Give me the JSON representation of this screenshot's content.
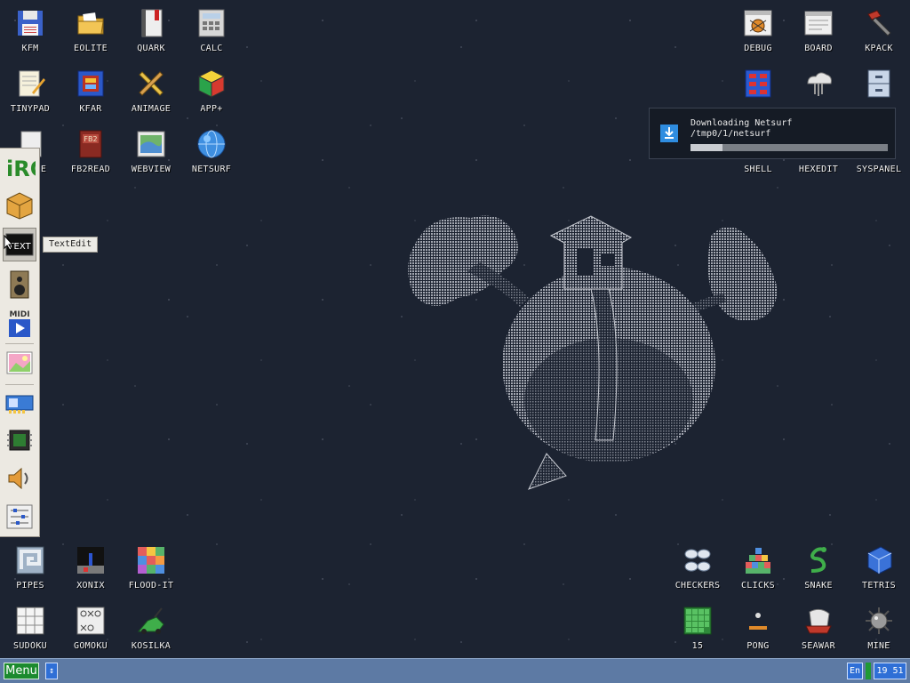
{
  "desktop": {
    "icons": [
      {
        "label": "KFM",
        "icon": "floppy-disk-icon"
      },
      {
        "label": "EOLITE",
        "icon": "folder-icon"
      },
      {
        "label": "QUARK",
        "icon": "book-icon"
      },
      {
        "label": "CALC",
        "icon": "calculator-icon"
      },
      {
        "label": "TINYPAD",
        "icon": "notepad-icon"
      },
      {
        "label": "KFAR",
        "icon": "archive-icon"
      },
      {
        "label": "ANIMAGE",
        "icon": "pencil-ruler-icon"
      },
      {
        "label": "APP+",
        "icon": "rubik-cube-icon"
      },
      {
        "label": "E",
        "icon": "document-icon"
      },
      {
        "label": "FB2READ",
        "icon": "fb2-book-icon"
      },
      {
        "label": "WEBVIEW",
        "icon": "map-window-icon"
      },
      {
        "label": "NETSURF",
        "icon": "globe-icon"
      },
      {
        "label": "DEBUG",
        "icon": "bug-window-icon"
      },
      {
        "label": "BOARD",
        "icon": "board-window-icon"
      },
      {
        "label": "KPACK",
        "icon": "hammer-icon"
      },
      {
        "label": "SHELL",
        "icon": "terminal-grid-icon"
      },
      {
        "label": "HEXEDIT",
        "icon": "cloud-tools-icon"
      },
      {
        "label": "SYSPANEL",
        "icon": "cabinet-icon"
      },
      {
        "label": "PIPES",
        "icon": "pipes-icon"
      },
      {
        "label": "XONIX",
        "icon": "xonix-icon"
      },
      {
        "label": "FLOOD-IT",
        "icon": "color-grid-icon"
      },
      {
        "label": "SUDOKU",
        "icon": "sudoku-icon"
      },
      {
        "label": "GOMOKU",
        "icon": "gomoku-icon"
      },
      {
        "label": "KOSILKA",
        "icon": "lawnmower-icon"
      },
      {
        "label": "CHECKERS",
        "icon": "checkers-icon"
      },
      {
        "label": "CLICKS",
        "icon": "blocks-icon"
      },
      {
        "label": "SNAKE",
        "icon": "snake-icon"
      },
      {
        "label": "TETRIS",
        "icon": "tetris-icon"
      },
      {
        "label": "15",
        "icon": "fifteen-puzzle-icon"
      },
      {
        "label": "PONG",
        "icon": "pong-icon"
      },
      {
        "label": "SEAWAR",
        "icon": "ship-icon"
      },
      {
        "label": "MINE",
        "icon": "mine-icon"
      }
    ]
  },
  "left_panel": {
    "items": [
      {
        "name": "irc-icon",
        "label": "iRC"
      },
      {
        "name": "package-icon",
        "label": ""
      },
      {
        "name": "text-edit-icon",
        "label": "TEXT"
      },
      {
        "name": "speaker-icon",
        "label": ""
      },
      {
        "name": "midi-player-icon",
        "label": "MIDI"
      },
      {
        "name": "picture-icon",
        "label": ""
      },
      {
        "name": "network-card-icon",
        "label": ""
      },
      {
        "name": "chip-icon",
        "label": ""
      },
      {
        "name": "volume-icon",
        "label": ""
      },
      {
        "name": "mixer-icon",
        "label": ""
      }
    ],
    "tooltip": "TextEdit"
  },
  "notification": {
    "title": "Downloading Netsurf",
    "path": "/tmp0/1/netsurf",
    "progress": 0.16
  },
  "taskbar": {
    "menu_label": "Menu",
    "switch_label": "↕",
    "lang_label": "En",
    "clock": "19 51"
  }
}
